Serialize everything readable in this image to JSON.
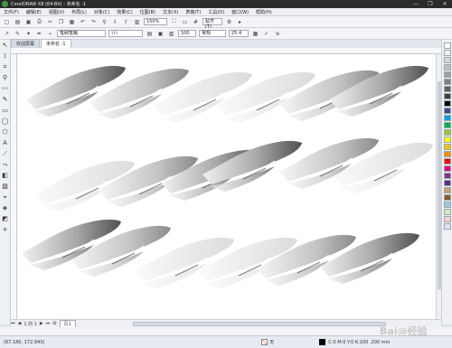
{
  "window": {
    "title": "CorelDRAW X8 (64-Bit) - 未命名 -1",
    "controls": [
      "—",
      "❐",
      "✕"
    ]
  },
  "menu": [
    "文件(F)",
    "编辑(E)",
    "视图(V)",
    "布局(L)",
    "对象(C)",
    "效果(C)",
    "位图(B)",
    "文本(X)",
    "表格(T)",
    "工具(O)",
    "窗口(W)",
    "帮助(H)"
  ],
  "toolbar": {
    "zoom": "150%",
    "snap": "贴齐(T)"
  },
  "propbar": {
    "brush_category": "笔刷笔触",
    "size_field": "100",
    "angle_field": "25.4",
    "mode": "常规"
  },
  "tabs": [
    {
      "label": "欢迎屏幕",
      "active": false
    },
    {
      "label": "未命名 -1",
      "active": true
    }
  ],
  "pagebar": {
    "page_info": "1 的 1",
    "page_tab": "页1"
  },
  "status": {
    "coords": "(67.180, 172.943)",
    "fill_label": "无",
    "color_info": "C:0 M:0 Y:0 K:100 .200 mm"
  },
  "watermark": "Bai@经验",
  "palette_colors": [
    "#ffffff",
    "#f0f0f0",
    "#d8d8d8",
    "#bfbfbf",
    "#a0a0a0",
    "#808080",
    "#606060",
    "#404040",
    "#000000",
    "#3d4a8f",
    "#00a0e0",
    "#00b050",
    "#9ac43c",
    "#ffff00",
    "#ffc000",
    "#ff8c00",
    "#ff0000",
    "#e6007e",
    "#8c2d8c",
    "#5b2d90",
    "#c8a070",
    "#8b5a2b",
    "#a0c8e0",
    "#d0e8c0",
    "#f8d0d0",
    "#e0e0ff"
  ]
}
